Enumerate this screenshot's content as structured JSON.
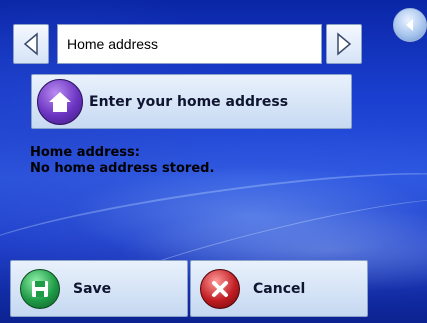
{
  "topbar": {
    "title": "Home address",
    "prev_icon": "chevron-left-icon",
    "next_icon": "chevron-right-icon",
    "back_icon": "back-arrow-icon"
  },
  "home_button": {
    "label": "Enter your home address",
    "icon": "house-icon"
  },
  "info": {
    "heading": "Home address:",
    "value": "No home address stored."
  },
  "actions": {
    "save_label": "Save",
    "save_icon": "floppy-disk-icon",
    "cancel_label": "Cancel",
    "cancel_icon": "cancel-x-icon"
  },
  "colors": {
    "background": "#1a3fd0",
    "button_face": "#dbe7f7",
    "save_icon": "#1f9b47",
    "cancel_icon": "#c01d22",
    "home_icon": "#6b34c2"
  }
}
